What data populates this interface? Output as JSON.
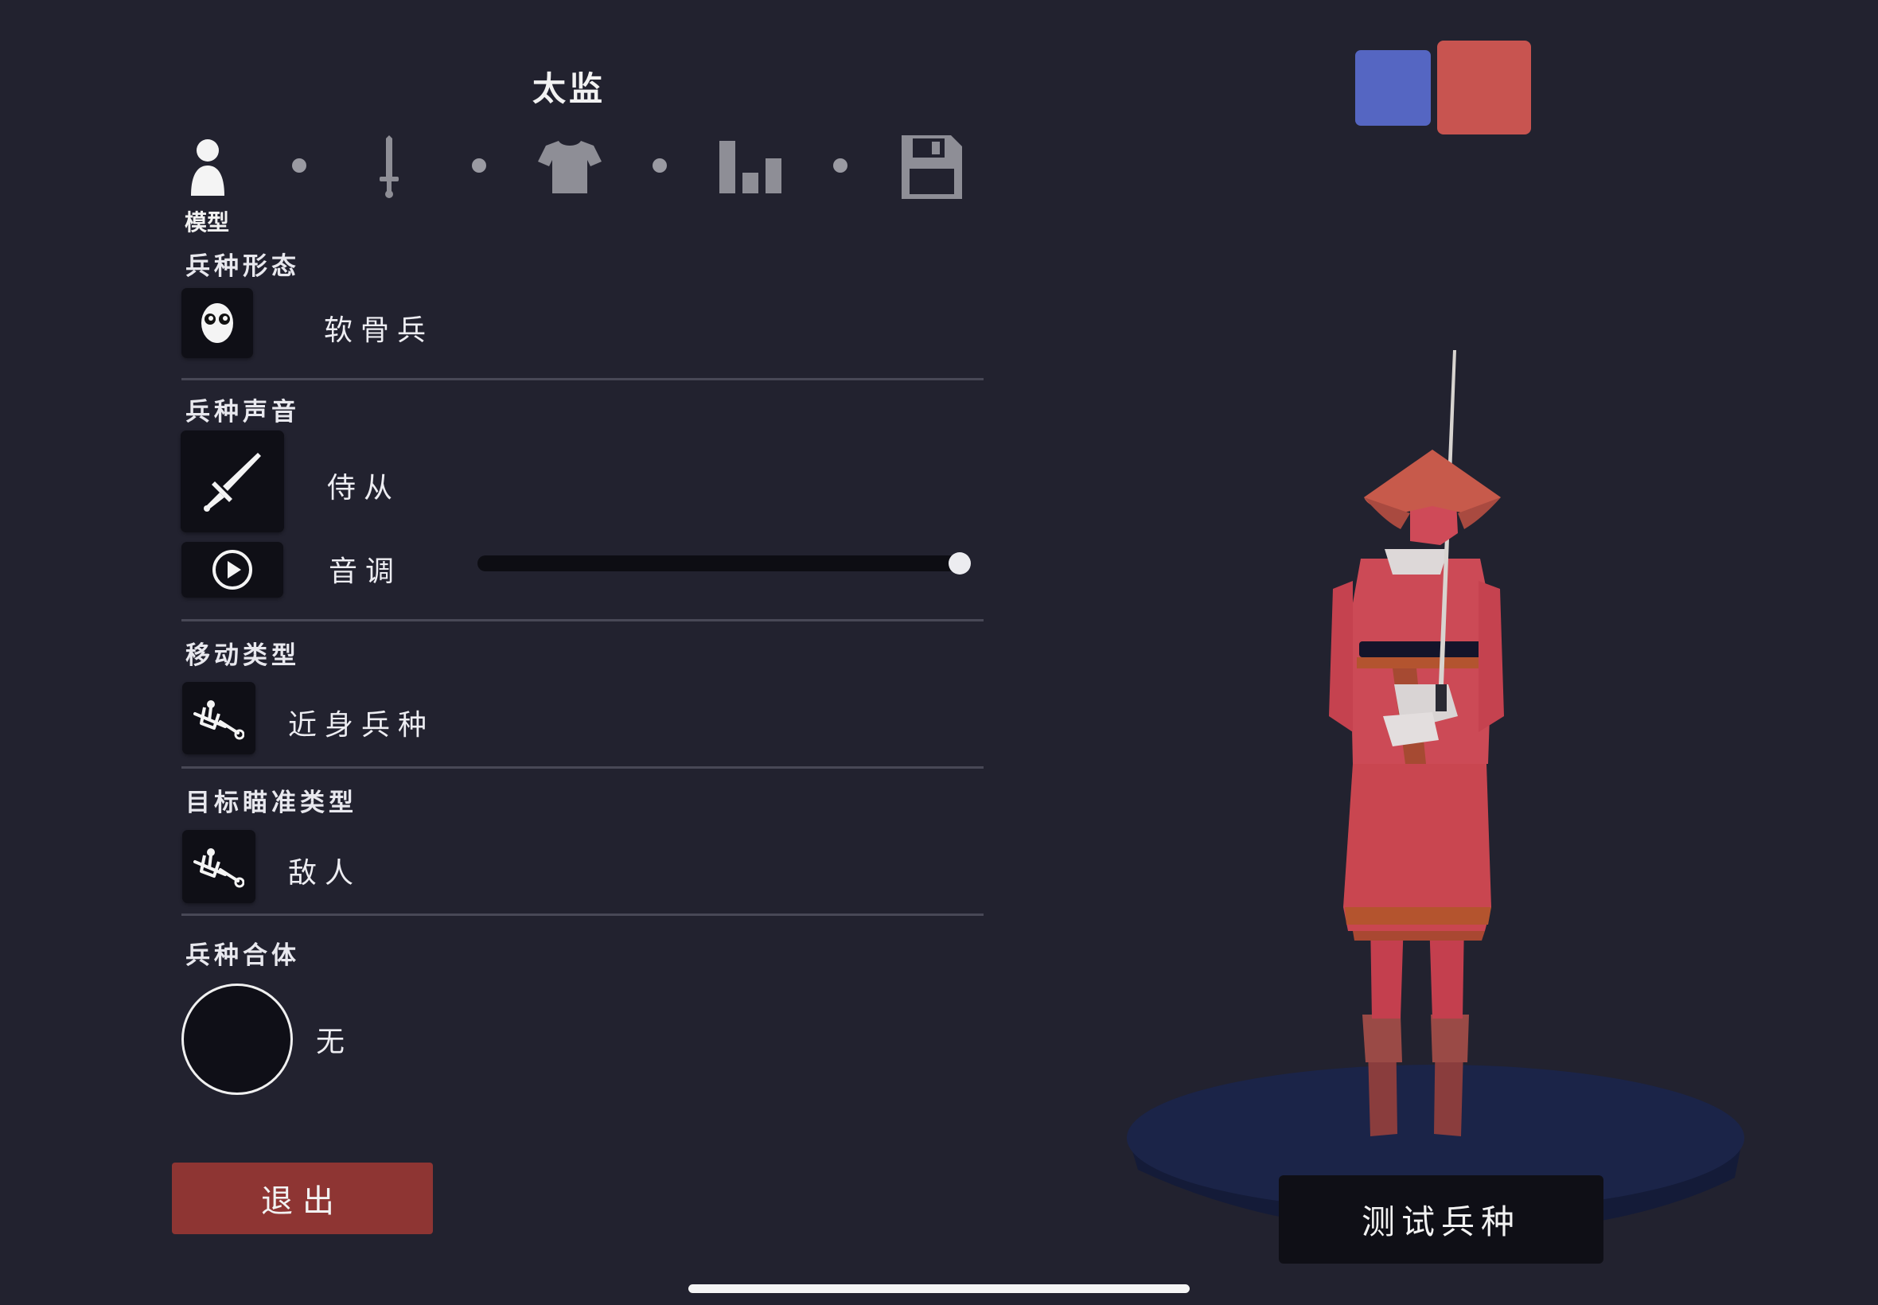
{
  "unit_name": "太监",
  "tabs": [
    {
      "icon": "person-icon",
      "label": "模型",
      "active": true
    },
    {
      "icon": "sword-icon"
    },
    {
      "icon": "shirt-icon"
    },
    {
      "icon": "stats-icon"
    },
    {
      "icon": "save-icon"
    }
  ],
  "tab_active_label": "模型",
  "sections": {
    "unit_form": {
      "label": "兵种形态",
      "value": "软骨兵",
      "icon": "face-icon"
    },
    "unit_voice": {
      "label": "兵种声音",
      "value": "侍从",
      "icon": "sword-icon",
      "pitch_label": "音调",
      "pitch_level": 1.0
    },
    "movement": {
      "label": "移动类型",
      "value": "近身兵种",
      "icon": "melee-icon"
    },
    "targeting": {
      "label": "目标瞄准类型",
      "value": "敌人",
      "icon": "target-icon"
    },
    "combination": {
      "label": "兵种合体",
      "value": "无"
    }
  },
  "buttons": {
    "exit": "退出",
    "test": "测试兵种"
  },
  "team_colors": {
    "blue": "#5566c2",
    "red": "#c85450",
    "selected": "red"
  }
}
